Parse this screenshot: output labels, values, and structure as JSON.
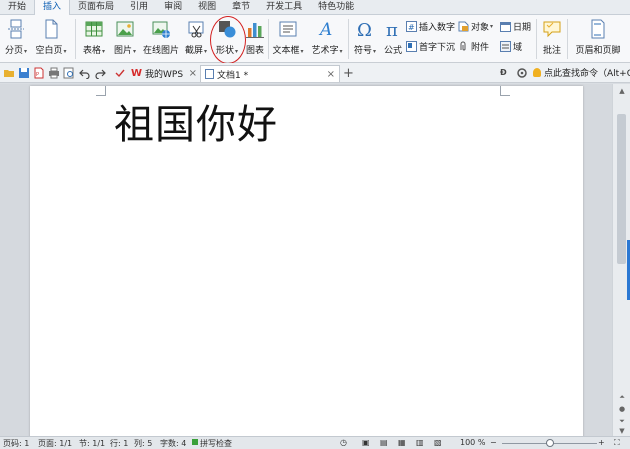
{
  "menu": {
    "tabs": [
      "开始",
      "插入",
      "页面布局",
      "引用",
      "审阅",
      "视图",
      "章节",
      "开发工具",
      "特色功能"
    ],
    "active": "插入"
  },
  "ribbon": {
    "page_break": "分页",
    "blank_page": "空白页",
    "table": "表格",
    "picture": "图片",
    "online_picture": "在线图片",
    "screenshot": "截屏",
    "shape": "形状",
    "chart": "图表",
    "textbox": "文本框",
    "wordart": "艺术字",
    "symbol": "符号",
    "formula": "公式",
    "insert_number": "插入数字",
    "object": "对象",
    "date": "日期",
    "drop_cap": "首字下沉",
    "attachment": "附件",
    "field": "域",
    "comment": "批注",
    "header_footer": "页眉和页脚",
    "caret": "▾",
    "highlight_color": "#d32020"
  },
  "toolbar": {
    "tabs": [
      {
        "label": "我的WPS",
        "close": "×"
      },
      {
        "label": "文档1 *",
        "close": "×"
      }
    ],
    "new_tab": "+",
    "command_search": "点此查找命令（Alt+Q）"
  },
  "document": {
    "text": "祖国你好"
  },
  "status": {
    "page": "页码: 1",
    "pages": "页面: 1/1",
    "section": "节: 1/1",
    "row": "行: 1",
    "col": "列: 5",
    "word_count": "字数: 4",
    "spell_check": "拼写检查",
    "zoom": "100 %",
    "zoom_out": "−",
    "zoom_in": "+",
    "zoom_level": 0.5
  },
  "colors": {
    "accent": "#0f61b5",
    "wps_red": "#d62b2b"
  }
}
